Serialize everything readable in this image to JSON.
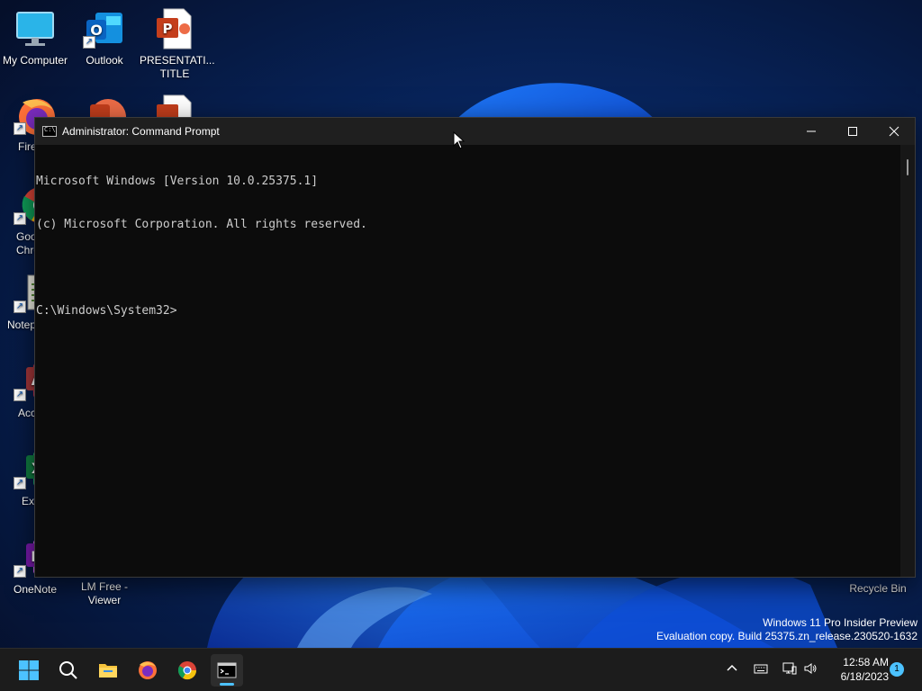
{
  "desktop": {
    "icons": [
      {
        "label": "My Computer",
        "icon": "monitor-icon"
      },
      {
        "label": "Outlook",
        "icon": "outlook-icon"
      },
      {
        "label": "PRESENTATI... TITLE",
        "icon": "powerpoint-file-icon"
      },
      {
        "label": "Fire",
        "icon": "firefox-icon"
      },
      {
        "label": "Goo Chro",
        "icon": "chrome-icon"
      },
      {
        "label": "Notep",
        "icon": "notepad-icon"
      },
      {
        "label": "Acc",
        "icon": "access-icon"
      },
      {
        "label": "Ex",
        "icon": "excel-icon"
      },
      {
        "label": "OneNote",
        "icon": "onenote-icon"
      },
      {
        "label": "LM Free - Viewer",
        "icon": "viewer-icon"
      },
      {
        "label": "Recycle Bin",
        "icon": "recycle-bin-icon"
      }
    ],
    "watermark": {
      "line1": "Windows 11 Pro Insider Preview",
      "line2": "Evaluation copy. Build 25375.zn_release.230520-1632"
    }
  },
  "window": {
    "title": "Administrator: Command Prompt",
    "icon_text": "C:\\",
    "console_lines": [
      "Microsoft Windows [Version 10.0.25375.1]",
      "(c) Microsoft Corporation. All rights reserved.",
      "",
      "C:\\Windows\\System32>"
    ]
  },
  "taskbar": {
    "items": [
      "start-icon",
      "search-icon",
      "file-explorer-icon",
      "firefox-icon",
      "chrome-icon",
      "command-prompt-icon"
    ],
    "clock": {
      "time": "12:58 AM",
      "date": "6/18/2023"
    },
    "notification_count": "1"
  },
  "colors": {
    "accent": "#4cc2ff",
    "console_bg": "#0c0c0c",
    "console_text": "#cccccc",
    "taskbar_bg": "#1c1c1c"
  }
}
